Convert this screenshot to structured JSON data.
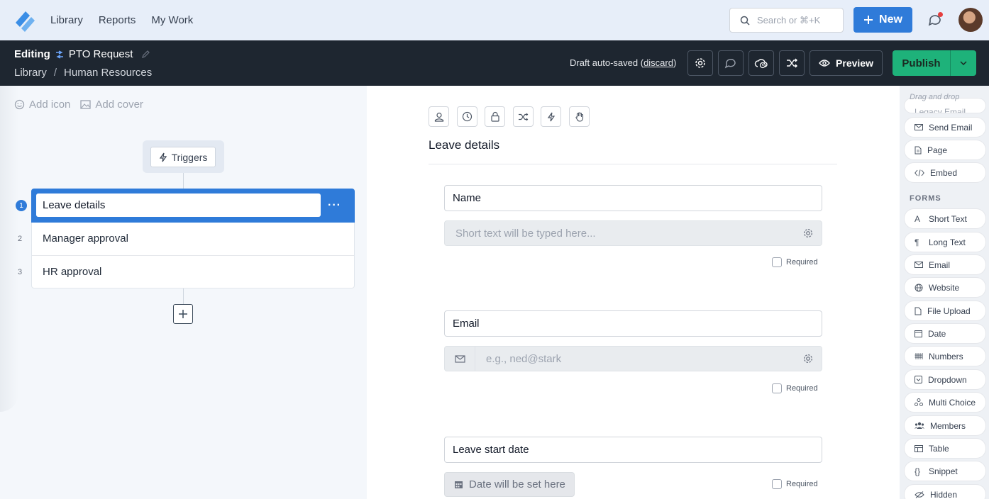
{
  "nav": {
    "links": [
      "Library",
      "Reports",
      "My Work"
    ],
    "search_placeholder": "Search or ⌘+K",
    "new_label": "New"
  },
  "editbar": {
    "editing_label": "Editing",
    "doc_title": "PTO Request",
    "breadcrumb": [
      "Library",
      "/",
      "Human Resources"
    ],
    "draft_text": "Draft auto-saved",
    "discard_label": "discard",
    "preview_label": "Preview",
    "publish_label": "Publish"
  },
  "left": {
    "add_icon": "Add icon",
    "add_cover": "Add cover",
    "triggers_label": "Triggers",
    "steps": [
      {
        "num": "1",
        "label": "Leave details"
      },
      {
        "num": "2",
        "label": "Manager approval"
      },
      {
        "num": "3",
        "label": "HR approval"
      }
    ],
    "more_label": "···"
  },
  "center": {
    "section_title": "Leave details",
    "fields": [
      {
        "label": "Name",
        "placeholder": "Short text will be typed here...",
        "required_label": "Required"
      },
      {
        "label": "Email",
        "placeholder": "e.g., ned@stark",
        "required_label": "Required"
      },
      {
        "label": "Leave start date",
        "placeholder": "Date will be set here",
        "required_label": "Required"
      }
    ]
  },
  "palette": {
    "hint": "Drag and drop",
    "top_items": [
      "Legacy Email",
      "Send Email",
      "Page",
      "Embed"
    ],
    "forms_heading": "FORMS",
    "form_items": [
      "Short Text",
      "Long Text",
      "Email",
      "Website",
      "File Upload",
      "Date",
      "Numbers",
      "Dropdown",
      "Multi Choice",
      "Members",
      "Table",
      "Snippet",
      "Hidden"
    ]
  },
  "colors": {
    "primary": "#2f7bd9",
    "publish": "#1eb27a",
    "header_dark": "#1e2630",
    "nav_bg": "#e7eef9"
  }
}
